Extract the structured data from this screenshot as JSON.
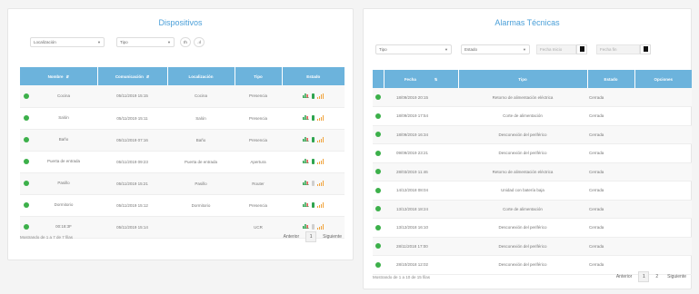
{
  "devices": {
    "title": "Dispositivos",
    "filters": {
      "location": "Localización",
      "type": "Tipo",
      "chart_button": "Ih",
      "signal_button": ".ıl"
    },
    "columns": [
      "Nombre",
      "Comunicación",
      "Localización",
      "Tipo",
      "Estado"
    ],
    "rows": [
      {
        "name": "Cocina",
        "comm": "05/11/2019 15:15",
        "location": "Cocina",
        "type": "Presencia",
        "battery": "#2ea44f"
      },
      {
        "name": "Salón",
        "comm": "05/11/2019 15:11",
        "location": "Salón",
        "type": "Presencia",
        "battery": "#2ea44f"
      },
      {
        "name": "Baño",
        "comm": "05/11/2019 07:16",
        "location": "Baño",
        "type": "Presencia",
        "battery": "#2ea44f"
      },
      {
        "name": "Puerta de entrada",
        "comm": "05/11/2019 09:23",
        "location": "Puerta de entrada",
        "type": "Apertura",
        "battery": "#2ea44f"
      },
      {
        "name": "Pasillo",
        "comm": "05/11/2019 15:21",
        "location": "Pasillo",
        "type": "Router",
        "battery": "#cfcfcf"
      },
      {
        "name": "Dormitorio",
        "comm": "05/11/2019 15:12",
        "location": "Dormitorio",
        "type": "Presencia",
        "battery": "#2ea44f"
      },
      {
        "name": "00:18:3F",
        "comm": "05/11/2019 15:14",
        "location": "",
        "type": "UCR",
        "battery": "#cfcfcf"
      }
    ],
    "footer": {
      "summary": "Mostrando de 1 a 7 de 7 filas",
      "prev": "Anterior",
      "page": "1",
      "next": "Siguiente"
    }
  },
  "alarms": {
    "title": "Alarmas Técnicas",
    "filters": {
      "type": "Tipo",
      "state": "Estado",
      "date_from": "Fecha Inicio",
      "date_to": "Fecha fin"
    },
    "columns": [
      "Fecha",
      "Tipo",
      "Estado",
      "Opciones"
    ],
    "rows": [
      {
        "date": "18/09/2019 20:15",
        "type": "Retorno de alimentación eléctrica",
        "state": "Cerrada"
      },
      {
        "date": "18/09/2019 17:54",
        "type": "Corte de alimentación",
        "state": "Cerrada"
      },
      {
        "date": "18/09/2019 16:34",
        "type": "Desconexión del periférico",
        "state": "Cerrada"
      },
      {
        "date": "09/09/2019 23:21",
        "type": "Desconexión del periférico",
        "state": "Cerrada"
      },
      {
        "date": "28/03/2019 11:46",
        "type": "Retorno de alimentación eléctrica",
        "state": "Cerrada"
      },
      {
        "date": "14/12/2018 08:04",
        "type": "Unidad con batería baja",
        "state": "Cerrada"
      },
      {
        "date": "13/12/2018 18:24",
        "type": "Corte de alimentación",
        "state": "Cerrada"
      },
      {
        "date": "13/12/2018 16:10",
        "type": "Desconexión del periférico",
        "state": "Cerrada"
      },
      {
        "date": "28/11/2018 17:00",
        "type": "Desconexión del periférico",
        "state": "Cerrada"
      },
      {
        "date": "28/10/2018 12:02",
        "type": "Desconexión del periférico",
        "state": "Cerrada"
      }
    ],
    "footer": {
      "summary": "Mostrando de 1 a 10 de 15 filas",
      "prev": "Anterior",
      "page1": "1",
      "page2": "2",
      "next": "Siguiente"
    }
  },
  "colors": {
    "accent": "#4a9fd8",
    "header": "#6cb3dc",
    "status_ok": "#3cb04a",
    "signal": "#f0a33c"
  },
  "icons": {
    "status": "status-dot-icon",
    "chart": "bar-chart-icon",
    "battery": "battery-icon",
    "signal": "signal-icon",
    "calendar": "calendar-icon"
  }
}
